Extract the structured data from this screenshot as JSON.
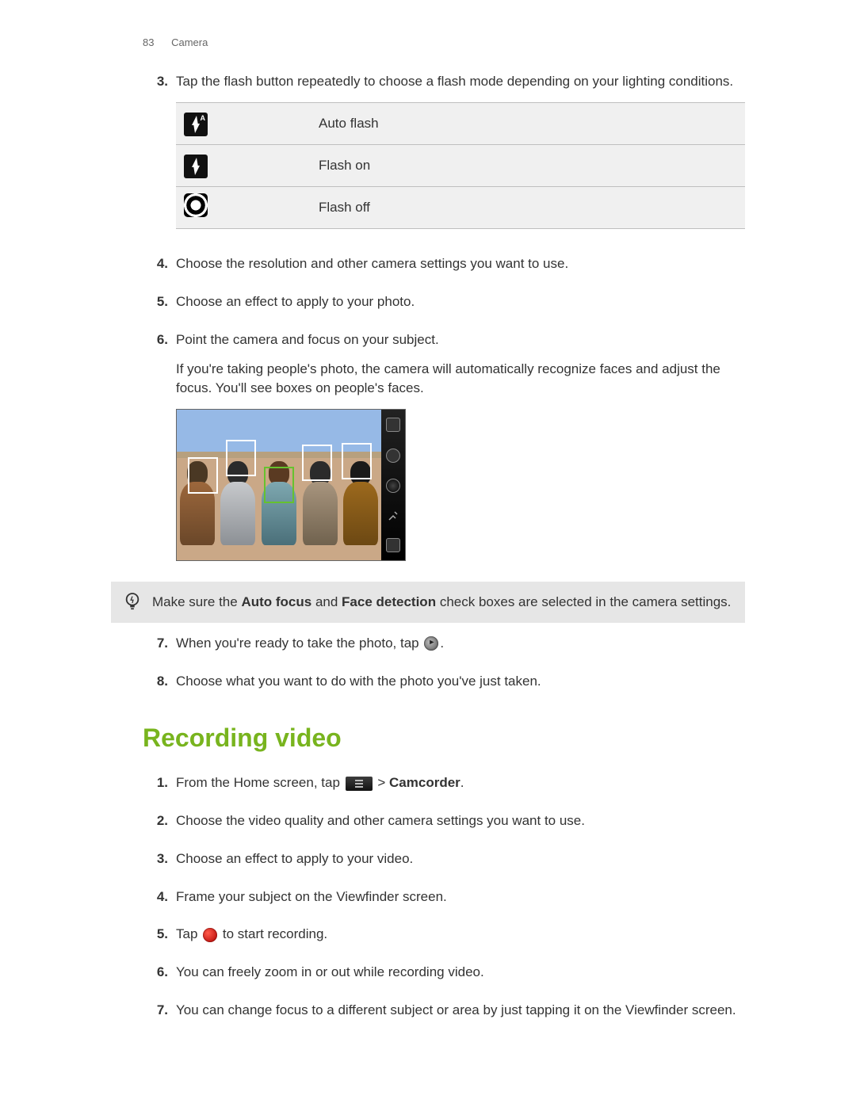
{
  "header": {
    "page_number": "83",
    "section_name": "Camera"
  },
  "photo_steps": {
    "s3": {
      "num": "3.",
      "text": "Tap the flash button repeatedly to choose a flash mode depending on your lighting conditions."
    },
    "flash_modes": {
      "auto": "Auto flash",
      "on": "Flash on",
      "off": "Flash off"
    },
    "s4": {
      "num": "4.",
      "text": "Choose the resolution and other camera settings you want to use."
    },
    "s5": {
      "num": "5.",
      "text": "Choose an effect to apply to your photo."
    },
    "s6": {
      "num": "6.",
      "text": "Point the camera and focus on your subject.",
      "sub": "If you're taking people's photo, the camera will automatically recognize faces and adjust the focus. You'll see boxes on people's faces."
    },
    "s7": {
      "num": "7.",
      "pre": "When you're ready to take the photo, tap ",
      "post": "."
    },
    "s8": {
      "num": "8.",
      "text": "Choose what you want to do with the photo you've just taken."
    }
  },
  "tip": {
    "pre": "Make sure the ",
    "b1": "Auto focus",
    "mid1": " and ",
    "b2": "Face detection",
    "post": " check boxes are selected in the camera settings."
  },
  "section_video": {
    "title": "Recording video",
    "s1": {
      "num": "1.",
      "pre": "From the Home screen, tap ",
      "mid": " > ",
      "link": "Camcorder",
      "post": "."
    },
    "s2": {
      "num": "2.",
      "text": "Choose the video quality and other camera settings you want to use."
    },
    "s3": {
      "num": "3.",
      "text": "Choose an effect to apply to your video."
    },
    "s4": {
      "num": "4.",
      "text": "Frame your subject on the Viewfinder screen."
    },
    "s5": {
      "num": "5.",
      "pre": "Tap ",
      "post": " to start recording."
    },
    "s6": {
      "num": "6.",
      "text": "You can freely zoom in or out while recording video."
    },
    "s7": {
      "num": "7.",
      "text": "You can change focus to a different subject or area by just tapping it on the Viewfinder screen."
    }
  }
}
